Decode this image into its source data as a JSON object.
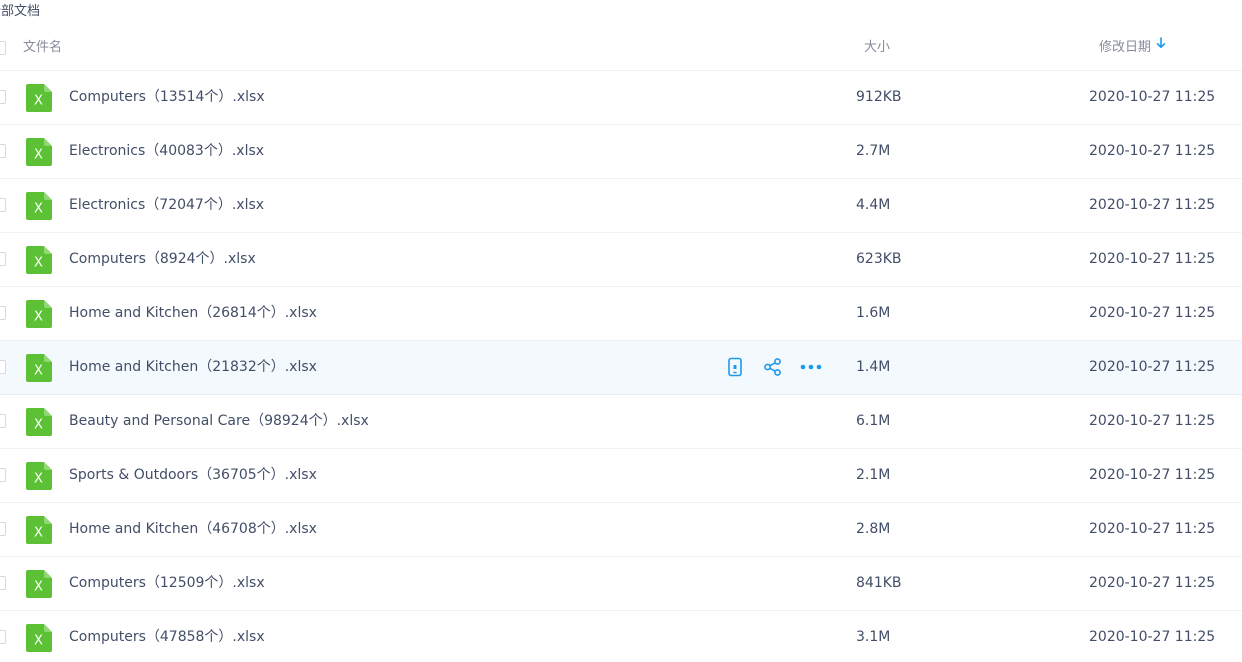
{
  "breadcrumb": {
    "label": "全部文档"
  },
  "table": {
    "headers": {
      "name": "文件名",
      "size": "大小",
      "date": "修改日期"
    },
    "sort": {
      "column": "date",
      "direction": "descending",
      "icon": "arrow-down-icon"
    },
    "file_icon": "excel-file-icon",
    "hover_actions": [
      "mobile-icon",
      "share-icon",
      "more-icon"
    ],
    "colors": {
      "accent": "#1b9aee",
      "excel_green": "#5cc135",
      "hover_row": "#f4f9fd"
    },
    "rows": [
      {
        "name": "Computers（13514个）.xlsx",
        "size": "912KB",
        "date": "2020-10-27 11:25"
      },
      {
        "name": "Electronics（40083个）.xlsx",
        "size": "2.7M",
        "date": "2020-10-27 11:25"
      },
      {
        "name": "Electronics（72047个）.xlsx",
        "size": "4.4M",
        "date": "2020-10-27 11:25"
      },
      {
        "name": "Computers（8924个）.xlsx",
        "size": "623KB",
        "date": "2020-10-27 11:25"
      },
      {
        "name": "Home and Kitchen（26814个）.xlsx",
        "size": "1.6M",
        "date": "2020-10-27 11:25"
      },
      {
        "name": "Home and Kitchen（21832个）.xlsx",
        "size": "1.4M",
        "date": "2020-10-27 11:25",
        "hovered": true
      },
      {
        "name": "Beauty and Personal Care（98924个）.xlsx",
        "size": "6.1M",
        "date": "2020-10-27 11:25"
      },
      {
        "name": "Sports & Outdoors（36705个）.xlsx",
        "size": "2.1M",
        "date": "2020-10-27 11:25"
      },
      {
        "name": "Home and Kitchen（46708个）.xlsx",
        "size": "2.8M",
        "date": "2020-10-27 11:25"
      },
      {
        "name": "Computers（12509个）.xlsx",
        "size": "841KB",
        "date": "2020-10-27 11:25"
      },
      {
        "name": "Computers（47858个）.xlsx",
        "size": "3.1M",
        "date": "2020-10-27 11:25"
      }
    ]
  }
}
